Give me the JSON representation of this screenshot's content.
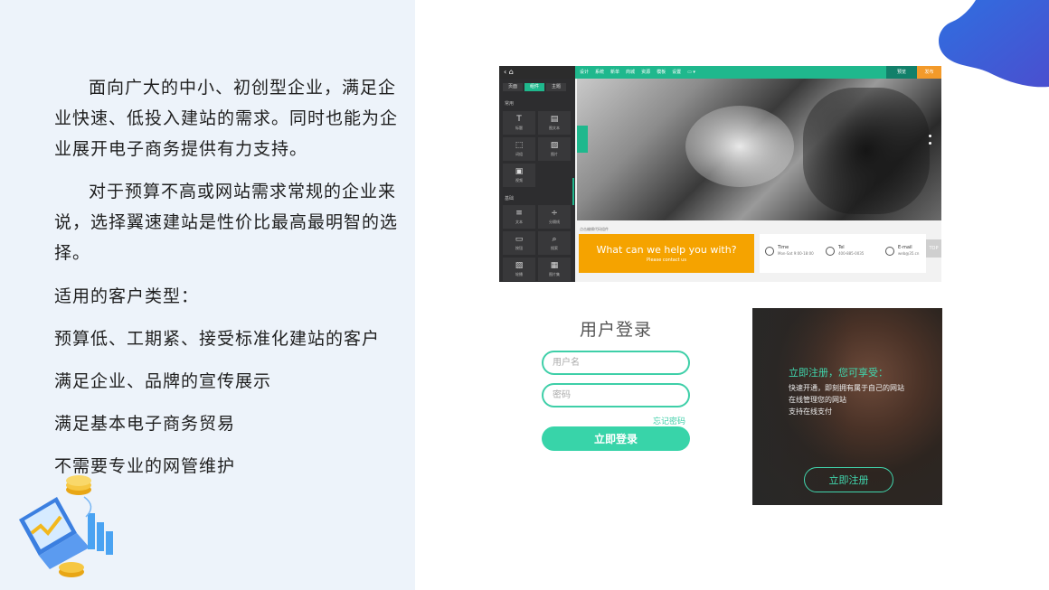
{
  "intro": {
    "para1": "面向广大的中小、初创型企业，满足企业快速、低投入建站的需求。同时也能为企业展开电子商务提供有力支持。",
    "para2": "对于预算不高或网站需求常规的企业来说，选择翼速建站是性价比最高最明智的选择。",
    "customers_heading": "适用的客户类型：",
    "customers": [
      "预算低、工期紧、接受标准化建站的客户",
      "满足企业、品牌的宣传展示",
      "满足基本电子商务贸易",
      "不需要专业的网管维护"
    ]
  },
  "builder": {
    "menu": [
      "设计",
      "系统",
      "新单",
      "商城",
      "资源",
      "模板",
      "设置"
    ],
    "preview_label": "预览",
    "publish_label": "发布",
    "side_tabs": [
      "页面",
      "组件",
      "主题"
    ],
    "group_common": "常用",
    "group_basic": "基础",
    "cells": [
      {
        "icon": "T",
        "label": "标题"
      },
      {
        "icon": "▤",
        "label": "图文本"
      },
      {
        "icon": "⬚",
        "label": "词组"
      },
      {
        "icon": "▨",
        "label": "图片"
      },
      {
        "icon": "▣",
        "label": "视频"
      },
      {
        "icon": "≡",
        "label": "文本"
      },
      {
        "icon": "÷",
        "label": "分隔线"
      },
      {
        "icon": "▭",
        "label": "按钮"
      },
      {
        "icon": "⌕",
        "label": "搜索"
      },
      {
        "icon": "▨",
        "label": "轮播"
      },
      {
        "icon": "▦",
        "label": "图片集"
      }
    ],
    "caption": "点击编辑代码组件",
    "cta_title": "What can we help you with?",
    "cta_sub": "Please contact us",
    "contact": [
      {
        "label": "Time",
        "sub": "Mon-Sat 9:00-18:00"
      },
      {
        "label": "Tel",
        "sub": "400-885-0035"
      },
      {
        "label": "E-mail",
        "sub": "web@35.cn"
      }
    ],
    "top_label": "TOP"
  },
  "login": {
    "title": "用户登录",
    "username_placeholder": "用户名",
    "password_placeholder": "密码",
    "forgot": "忘记密码",
    "submit": "立即登录"
  },
  "register": {
    "title": "立即注册，您可享受：",
    "lines": [
      "快速开通，即刻拥有属于自己的网站",
      "在线管理您的网站",
      "支持在线支付"
    ],
    "button": "立即注册"
  },
  "colors": {
    "accent": "#38d4a9",
    "builder_green": "#1fb88d",
    "cta_orange": "#f5a300",
    "left_bg": "#edf3fa",
    "blob_blue": "#2f6fe0"
  }
}
